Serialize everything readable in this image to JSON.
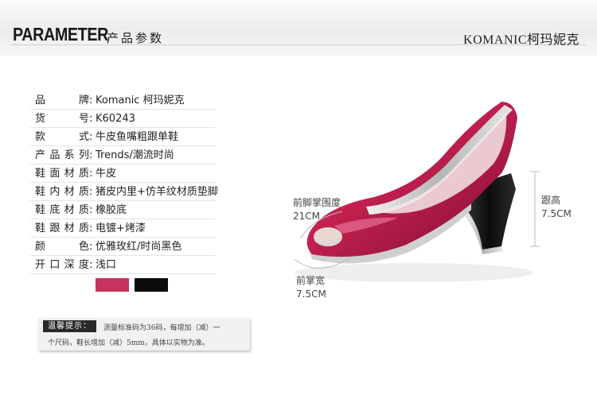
{
  "header": {
    "title_en": "PARAMETER",
    "title_cn": "产品参数",
    "brand": "KOMANIC柯玛妮克"
  },
  "params": [
    {
      "label": "品牌",
      "value": "Komanic 柯玛妮克"
    },
    {
      "label": "货号",
      "value": "K60243"
    },
    {
      "label": "款式",
      "value": "牛皮鱼嘴粗跟单鞋"
    },
    {
      "label": "产品系列",
      "value": "Trends/潮流时尚"
    },
    {
      "label": "鞋面材质",
      "value": "牛皮"
    },
    {
      "label": "鞋内材质",
      "value": "猪皮内里+仿羊纹材质垫脚"
    },
    {
      "label": "鞋底材质",
      "value": "橡胶底"
    },
    {
      "label": "鞋跟材质",
      "value": "电镀+烤漆"
    },
    {
      "label": "颜色",
      "value": "优雅玫红/时尚黑色"
    },
    {
      "label": "开口深度",
      "value": "浅口"
    }
  ],
  "swatches": [
    {
      "name": "优雅玫红",
      "color": "#c9325e"
    },
    {
      "name": "时尚黑色",
      "color": "#0c0c0c"
    }
  ],
  "tips": {
    "label": "温馨提示：",
    "line1": "测量标准码为36码，每增加（减）一",
    "line2": "个尺码，鞋长增加（减）5mm，具体以实物为准。"
  },
  "measurements": {
    "forefoot_circ_label": "前脚掌围度",
    "forefoot_circ_value": "21CM",
    "heel_label": "跟高",
    "heel_value": "7.5CM",
    "forefoot_width_label": "前掌宽",
    "forefoot_width_value": "7.5CM"
  },
  "colors": {
    "shoe_body": "#c2204f",
    "shoe_trim": "#c8c8c8",
    "heel": "#141414"
  }
}
